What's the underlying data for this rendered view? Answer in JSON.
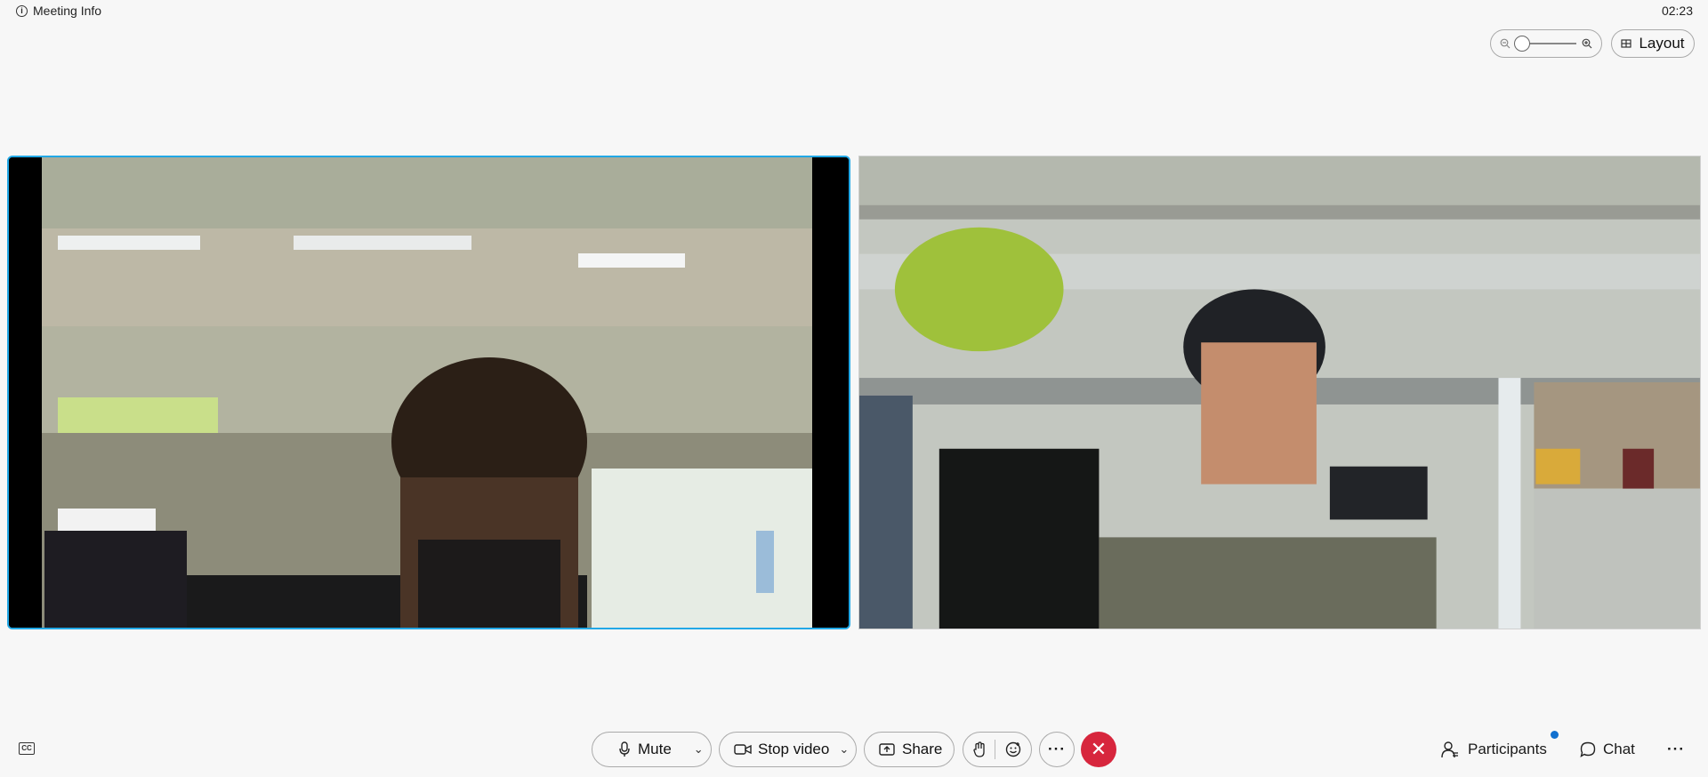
{
  "header": {
    "meeting_info_label": "Meeting Info",
    "clock": "02:23",
    "layout_label": "Layout"
  },
  "videos": {
    "left": {
      "active_speaker": true,
      "border_color": "#22a8e6"
    },
    "right": {
      "active_speaker": false
    }
  },
  "controls": {
    "mute_label": "Mute",
    "stop_video_label": "Stop video",
    "share_label": "Share",
    "more_glyph": "···",
    "end_glyph": "✕",
    "end_color": "#d7263d"
  },
  "right_controls": {
    "participants_label": "Participants",
    "chat_label": "Chat",
    "overflow_glyph": "···",
    "notification_dot_color": "#1170cf"
  },
  "icons": [
    "info-icon",
    "zoom-out-icon",
    "zoom-in-icon",
    "layout-grid-icon",
    "closed-caption-icon",
    "microphone-icon",
    "chevron-down-icon",
    "video-camera-icon",
    "share-icon",
    "raise-hand-icon",
    "reaction-emoji-icon",
    "more-icon",
    "end-call-icon",
    "participants-icon",
    "chat-icon"
  ]
}
